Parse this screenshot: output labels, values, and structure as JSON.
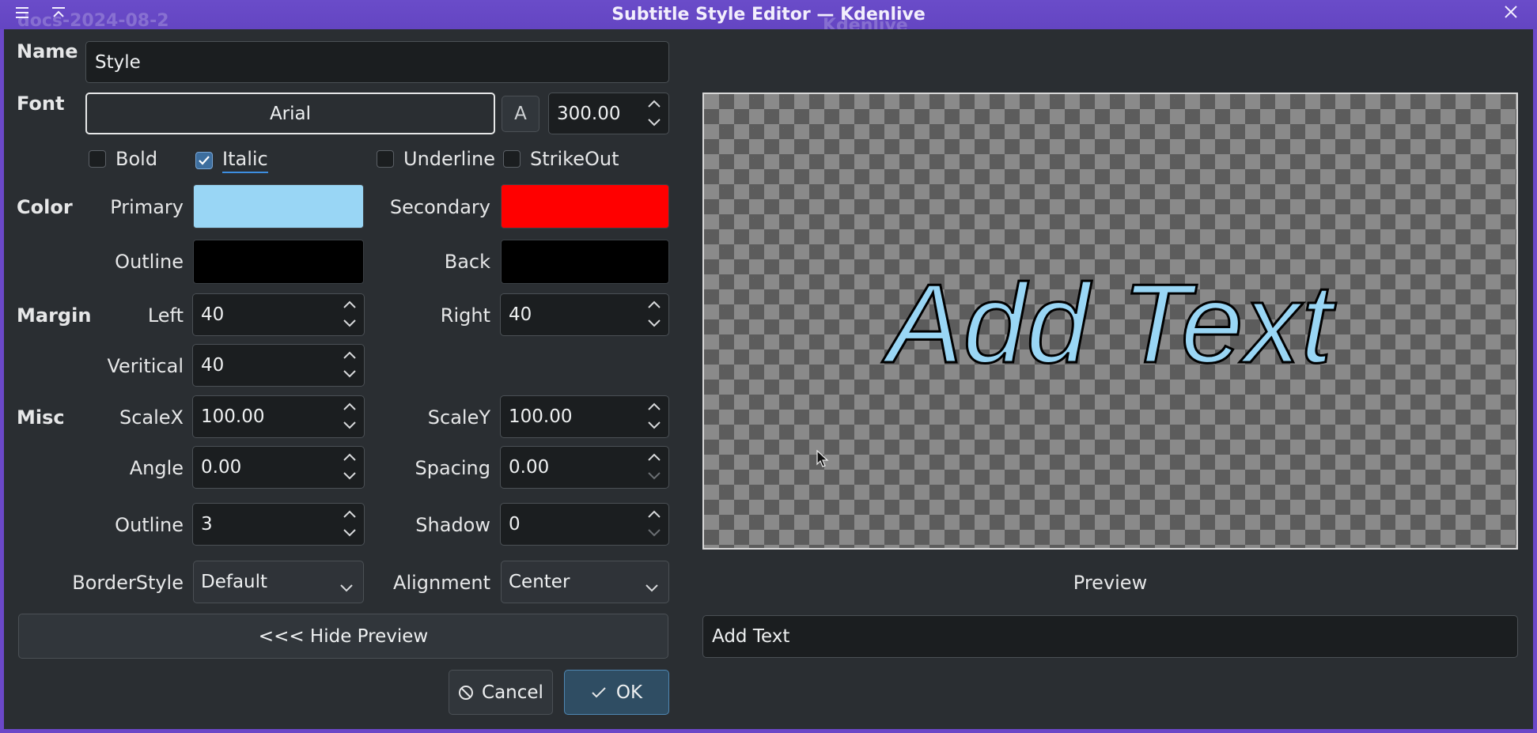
{
  "window": {
    "title": "Subtitle Style Editor — Kdenlive",
    "bg_title_ghost": "docs-2024-08-2",
    "bg_title_ghost2": "Kdenlive"
  },
  "form": {
    "name_label": "Name",
    "name_value": "Style",
    "font_label": "Font",
    "font_button": "Arial",
    "font_icon_button": "A",
    "font_size": "300.00",
    "bold_label": "Bold",
    "bold_checked": false,
    "italic_label": "Italic",
    "italic_checked": true,
    "underline_label": "Underline",
    "underline_checked": false,
    "strikeout_label": "StrikeOut",
    "strikeout_checked": false,
    "color_label": "Color",
    "primary_label": "Primary",
    "primary_color": "#99d6f5",
    "secondary_label": "Secondary",
    "secondary_color": "#ff0000",
    "outline_color_label": "Outline",
    "outline_color": "#000000",
    "back_label": "Back",
    "back_color": "#000000",
    "margin_label": "Margin",
    "left_label": "Left",
    "left_value": "40",
    "right_label": "Right",
    "right_value": "40",
    "vertical_label": "Veritical",
    "vertical_value": "40",
    "misc_label": "Misc",
    "scalex_label": "ScaleX",
    "scalex_value": "100.00",
    "scaley_label": "ScaleY",
    "scaley_value": "100.00",
    "angle_label": "Angle",
    "angle_value": "0.00",
    "spacing_label": "Spacing",
    "spacing_value": "0.00",
    "outline_label": "Outline",
    "outline_value": "3",
    "shadow_label": "Shadow",
    "shadow_value": "0",
    "borderstyle_label": "BorderStyle",
    "borderstyle_value": "Default",
    "alignment_label": "Alignment",
    "alignment_value": "Center",
    "hide_preview_button": "<<< Hide Preview",
    "cancel_button": "Cancel",
    "ok_button": "OK"
  },
  "preview": {
    "sample_text": "Add Text",
    "caption": "Preview",
    "text_input_value": "Add Text"
  },
  "icons": {
    "menu": "hamburger-menu-icon",
    "keep_above": "keep-above-icon",
    "close": "close-icon",
    "cancel": "cancel-circle-icon",
    "ok": "checkmark-icon"
  }
}
